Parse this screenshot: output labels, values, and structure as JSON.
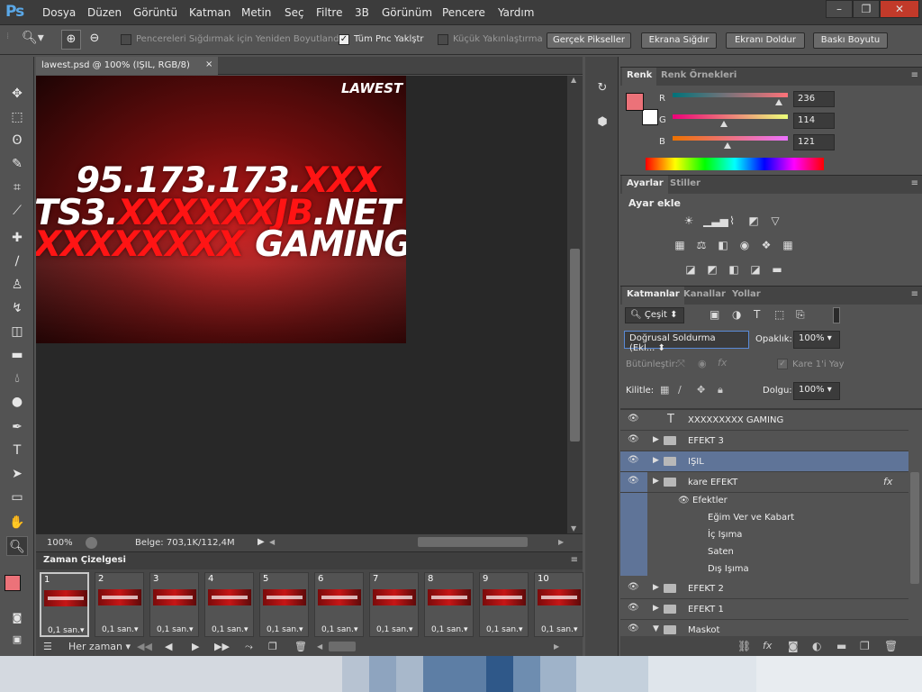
{
  "app": {
    "logo": "Ps"
  },
  "menu": [
    "Dosya",
    "Düzen",
    "Görüntü",
    "Katman",
    "Metin",
    "Seç",
    "Filtre",
    "3B",
    "Görünüm",
    "Pencere",
    "Yardım"
  ],
  "window_controls": {
    "minimize": "–",
    "restore": "❐",
    "close": "✕"
  },
  "options": {
    "resize_windows_label": "Pencereleri Sığdırmak için Yeniden Boyutlandır",
    "resize_windows_checked": false,
    "all_windows_label": "Tüm Pnc Yaklştr",
    "all_windows_checked": true,
    "scrubby_label": "Küçük Yakınlaştırma",
    "scrubby_checked": false,
    "actual_pixels": "Gerçek Pikseller",
    "fit_screen": "Ekrana Sığdır",
    "fill_screen": "Ekranı Doldur",
    "print_size": "Baskı Boyutu"
  },
  "document": {
    "tab_title": "lawest.psd @ 100% (IŞIL, RGB/8)",
    "tab_close": "×",
    "zoom": "100%",
    "doc_info": "Belge: 703,1K/112,4M"
  },
  "artwork": {
    "logo": "LAWEST",
    "line1_white": "95.173.173.",
    "line1_red": "XXX",
    "line2_white_a": "TS3.",
    "line2_red": "XXXXXXJB",
    "line2_white_b": ".NET",
    "line3_red": "XXXXXXXX",
    "line3_white": " GAMING"
  },
  "timeline": {
    "title": "Zaman Çizelgesi",
    "frames": [
      {
        "num": "1",
        "dur": "0,1 san.▾",
        "selected": true
      },
      {
        "num": "2",
        "dur": "0,1 san.▾"
      },
      {
        "num": "3",
        "dur": "0,1 san.▾"
      },
      {
        "num": "4",
        "dur": "0,1 san.▾"
      },
      {
        "num": "5",
        "dur": "0,1 san.▾"
      },
      {
        "num": "6",
        "dur": "0,1 san.▾"
      },
      {
        "num": "7",
        "dur": "0,1 san.▾"
      },
      {
        "num": "8",
        "dur": "0,1 san.▾"
      },
      {
        "num": "9",
        "dur": "0,1 san.▾"
      },
      {
        "num": "10",
        "dur": "0,1 san.▾"
      }
    ],
    "loop": "Her zaman"
  },
  "color_panel": {
    "tabs": [
      "Renk",
      "Renk Örnekleri"
    ],
    "r_label": "R",
    "g_label": "G",
    "b_label": "B",
    "r": "236",
    "g": "114",
    "b": "121",
    "r_level": 0.925,
    "g_level": 0.447,
    "b_level": 0.475,
    "fg_color": "#ec7279"
  },
  "adjustments": {
    "tabs": [
      "Ayarlar",
      "Stiller"
    ],
    "heading": "Ayar ekle",
    "icons": [
      "brightness-icon",
      "levels-icon",
      "curves-icon",
      "exposure-icon",
      "vibrance-icon",
      "hue-saturation-icon",
      "color-balance-icon",
      "black-white-icon",
      "photo-filter-icon",
      "channel-mixer-icon",
      "color-lookup-icon",
      "invert-icon",
      "posterize-icon",
      "threshold-icon",
      "gradient-map-icon",
      "selective-color-icon"
    ]
  },
  "layers_panel": {
    "tabs": [
      "Katmanlar",
      "Kanallar",
      "Yollar"
    ],
    "filter_kind": "Çeşit",
    "blend_mode": "Doğrusal Soldurma (Ekl...",
    "opacity_label": "Opaklık:",
    "opacity": "100%",
    "unify_label": "Bütünleştir:",
    "propagate_label": "Kare 1'i Yay",
    "lock_label": "Kilitle:",
    "fill_label": "Dolgu:",
    "fill": "100%",
    "layers": [
      {
        "name": "XXXXXXXXX GAMING",
        "kind": "text"
      },
      {
        "name": "EFEKT 3",
        "kind": "folder"
      },
      {
        "name": "IŞIL",
        "kind": "folder",
        "selected": true
      },
      {
        "name": "kare EFEKT",
        "kind": "folder",
        "fx": "fx"
      },
      {
        "name": "Efektler",
        "kind": "effects-header"
      },
      {
        "name": "Eğim Ver ve Kabart",
        "kind": "effect"
      },
      {
        "name": "İç Işıma",
        "kind": "effect"
      },
      {
        "name": "Saten",
        "kind": "effect"
      },
      {
        "name": "Dış Işıma",
        "kind": "effect"
      },
      {
        "name": "EFEKT 2",
        "kind": "folder"
      },
      {
        "name": "EFEKT 1",
        "kind": "folder"
      },
      {
        "name": "Maskot",
        "kind": "folder-open"
      }
    ]
  }
}
